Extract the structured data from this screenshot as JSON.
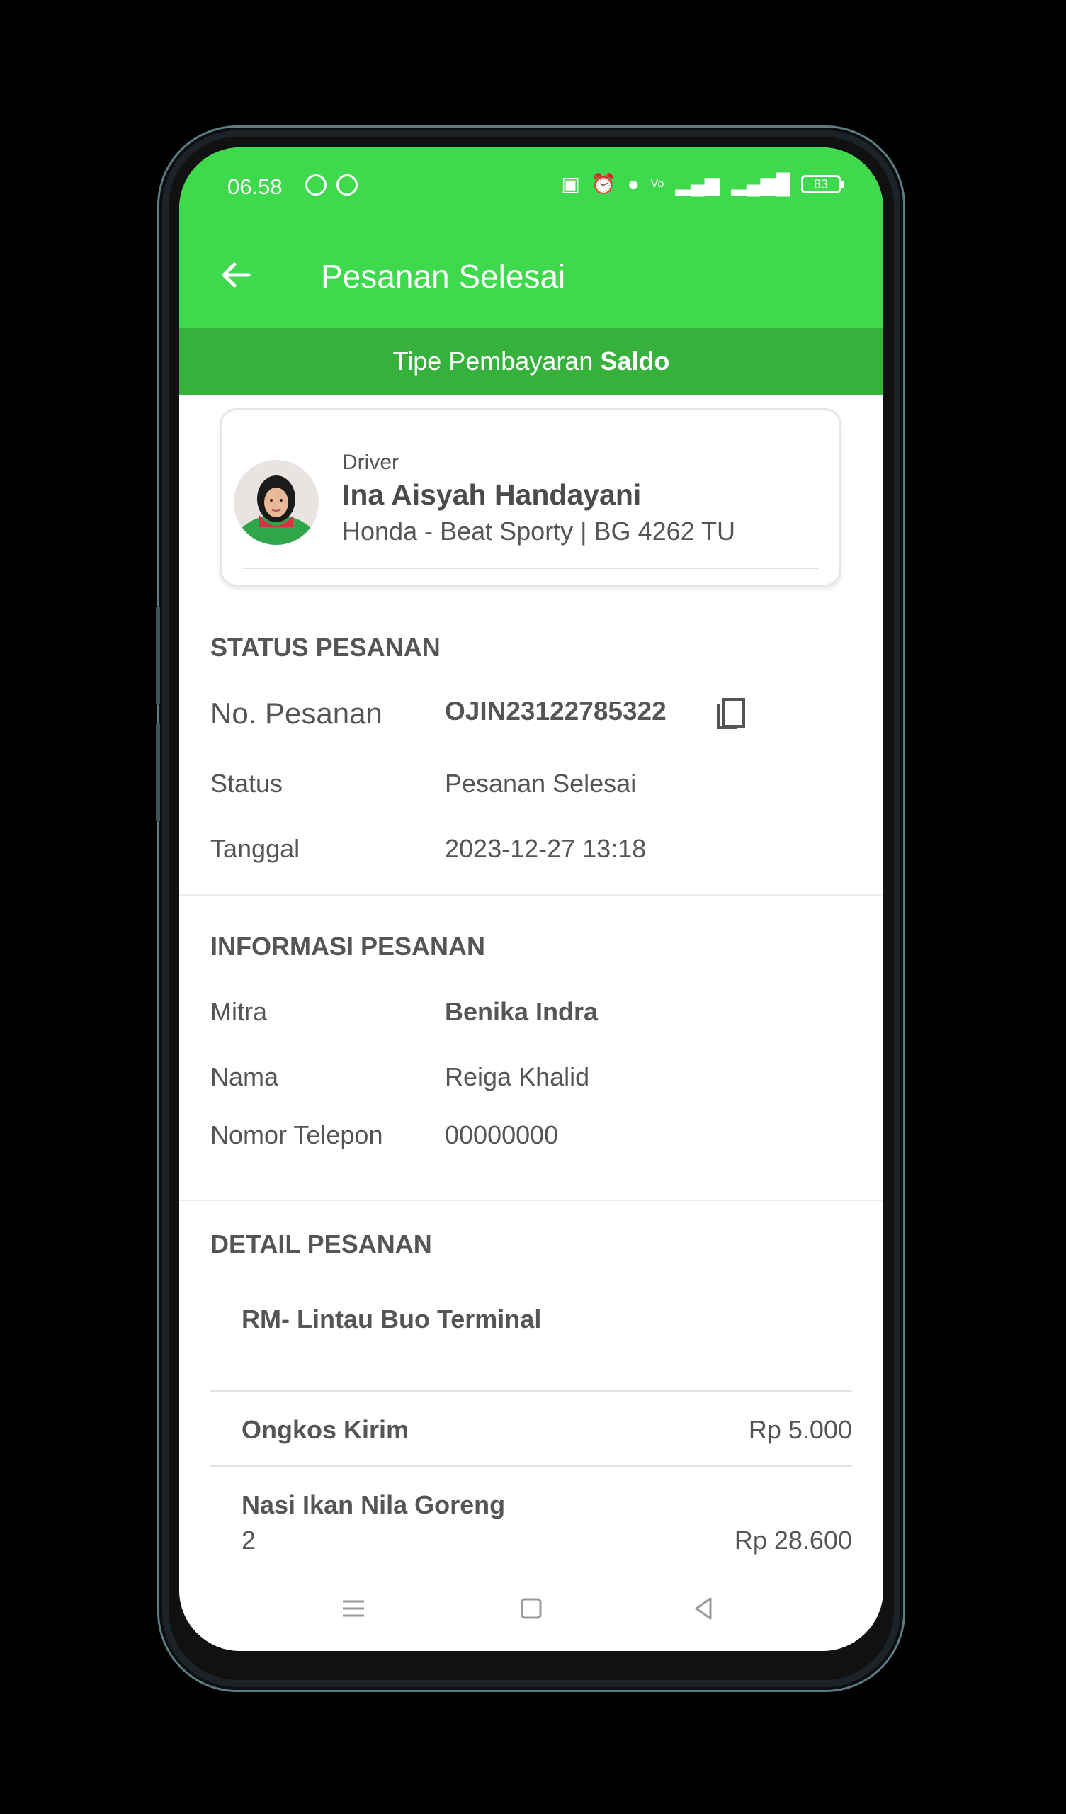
{
  "status_bar": {
    "time": "06.58",
    "battery": "83"
  },
  "app_bar": {
    "title": "Pesanan Selesai"
  },
  "payment": {
    "prefix": "Tipe Pembayaran",
    "type": "Saldo"
  },
  "driver": {
    "label": "Driver",
    "name": "Ina Aisyah Handayani",
    "vehicle": "Honda - Beat Sporty | BG 4262 TU"
  },
  "status_section": {
    "title": "STATUS PESANAN",
    "order_no_label": "No. Pesanan",
    "order_no": "OJIN23122785322",
    "status_label": "Status",
    "status": "Pesanan Selesai",
    "date_label": "Tanggal",
    "date": "2023-12-27 13:18"
  },
  "info_section": {
    "title": "INFORMASI PESANAN",
    "partner_label": "Mitra",
    "partner": "Benika Indra",
    "name_label": "Nama",
    "name": "Reiga Khalid",
    "phone_label": "Nomor Telepon",
    "phone": "00000000"
  },
  "detail_section": {
    "title": "DETAIL PESANAN",
    "merchant": "RM- Lintau Buo Terminal",
    "shipping_label": "Ongkos Kirim",
    "shipping_price": "Rp 5.000",
    "items": [
      {
        "name": "Nasi Ikan Nila Goreng",
        "qty": "2",
        "price": "Rp 28.600"
      }
    ]
  },
  "colors": {
    "primary": "#3ed94c",
    "primary_dark": "#35b13c"
  }
}
